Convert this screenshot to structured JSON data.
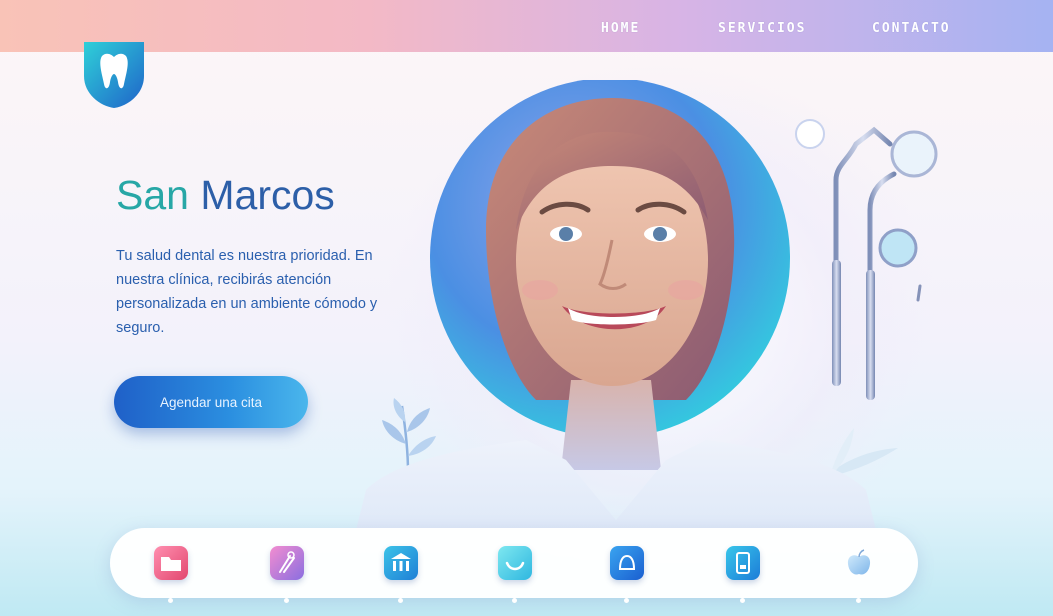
{
  "nav": {
    "items": [
      {
        "label": "HOME"
      },
      {
        "label": "SERVICIOS"
      },
      {
        "label": "CONTACTO"
      }
    ]
  },
  "brand": {
    "name_part1": "San",
    "name_part2": "Marcos",
    "logo_icon": "tooth-icon"
  },
  "hero": {
    "tagline": "Tu salud dental es nuestra prioridad. En nuestra clínica, recibirás atención personalizada en un ambiente cómodo y seguro.",
    "cta_label": "Agendar una cita"
  },
  "dock": {
    "icons": [
      "folder-icon",
      "tooth-tools-icon",
      "clinic-icon",
      "smile-icon",
      "tooth-shield-icon",
      "phone-icon",
      "apple-icon"
    ]
  },
  "colors": {
    "accent_blue": "#2a5fae",
    "accent_teal": "#27a7a6",
    "cta_start": "#1f60c8",
    "cta_end": "#4ab6ec"
  }
}
